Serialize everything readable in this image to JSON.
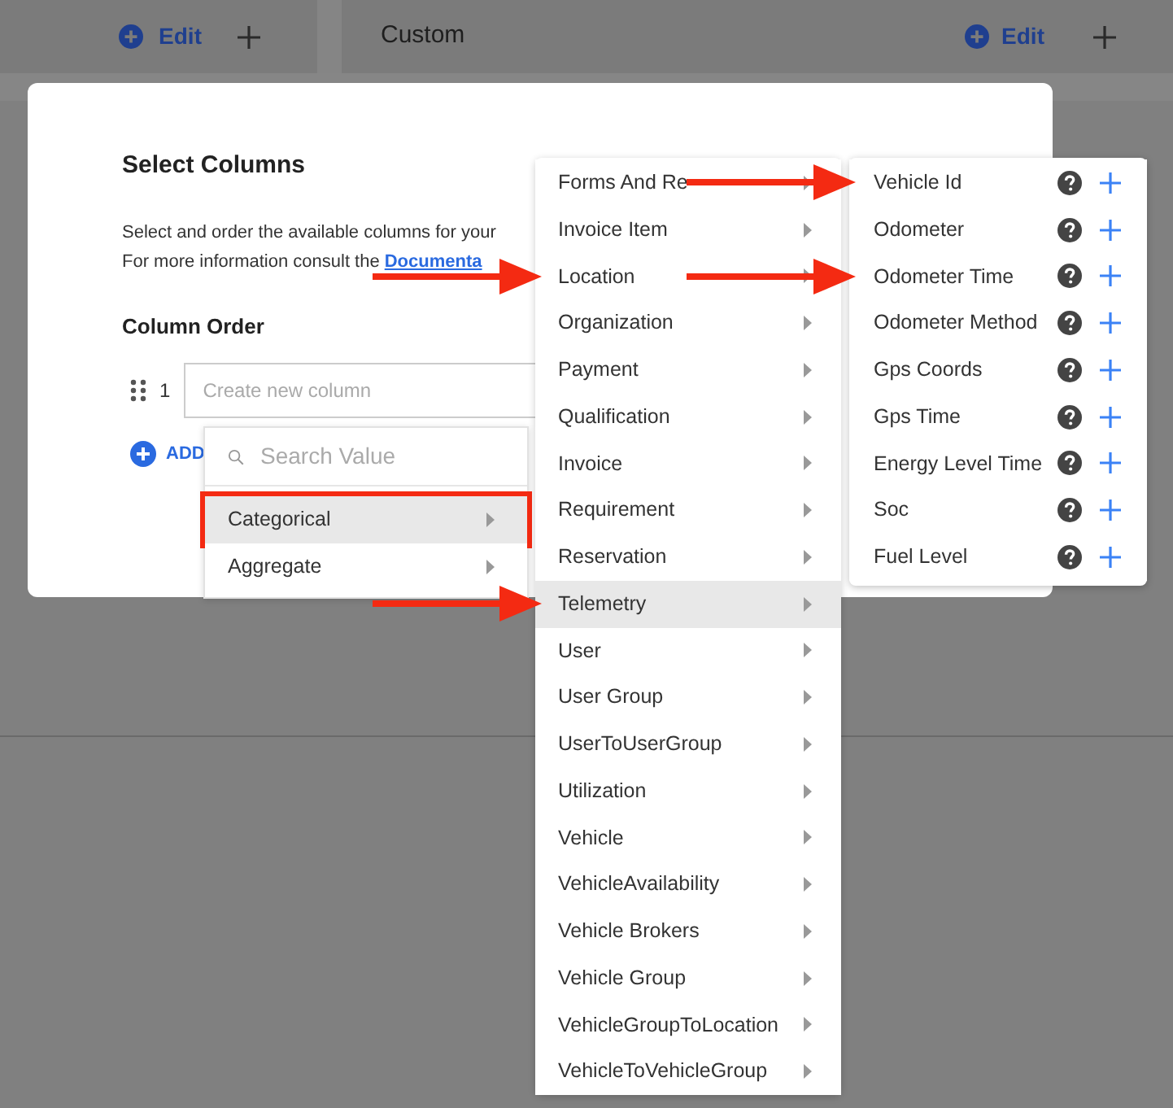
{
  "header": {
    "left_edit": "Edit",
    "custom_title": "Custom",
    "right_edit": "Edit"
  },
  "modal": {
    "title": "Select Columns",
    "description": "Select and order the available columns for your",
    "info_text": "For more information consult the ",
    "info_link": "Documenta",
    "section_label": "Column Order",
    "rows": [
      {
        "number": "1",
        "placeholder": "Create new column"
      }
    ],
    "add_label": "ADD"
  },
  "search_menu": {
    "placeholder": "Search Value",
    "items": [
      {
        "label": "Categorical",
        "selected": true,
        "boxed": true
      },
      {
        "label": "Aggregate",
        "selected": false,
        "boxed": false
      }
    ]
  },
  "category_menu": {
    "items": [
      {
        "label": "Forms And Re",
        "selected": false,
        "arrow": false
      },
      {
        "label": "Invoice Item",
        "selected": false,
        "arrow": false
      },
      {
        "label": "Location",
        "selected": false,
        "arrow": true
      },
      {
        "label": "Organization",
        "selected": false,
        "arrow": false
      },
      {
        "label": "Payment",
        "selected": false,
        "arrow": false
      },
      {
        "label": "Qualification",
        "selected": false,
        "arrow": false
      },
      {
        "label": "Invoice",
        "selected": false,
        "arrow": false
      },
      {
        "label": "Requirement",
        "selected": false,
        "arrow": false
      },
      {
        "label": "Reservation",
        "selected": false,
        "arrow": false
      },
      {
        "label": "Telemetry",
        "selected": true,
        "arrow": true
      },
      {
        "label": "User",
        "selected": false,
        "arrow": false
      },
      {
        "label": "User Group",
        "selected": false,
        "arrow": false
      },
      {
        "label": "UserToUserGroup",
        "selected": false,
        "arrow": false
      },
      {
        "label": "Utilization",
        "selected": false,
        "arrow": false
      },
      {
        "label": "Vehicle",
        "selected": false,
        "arrow": false
      },
      {
        "label": "VehicleAvailability",
        "selected": false,
        "arrow": false
      },
      {
        "label": "Vehicle Brokers",
        "selected": false,
        "arrow": false
      },
      {
        "label": "Vehicle Group",
        "selected": false,
        "arrow": false
      },
      {
        "label": "VehicleGroupToLocation",
        "selected": false,
        "arrow": false
      },
      {
        "label": "VehicleToVehicleGroup",
        "selected": false,
        "arrow": false
      }
    ]
  },
  "field_menu": {
    "items": [
      {
        "label": "Vehicle Id",
        "arrow": true
      },
      {
        "label": "Odometer",
        "arrow": false
      },
      {
        "label": "Odometer Time",
        "arrow": true
      },
      {
        "label": "Odometer Method",
        "arrow": false
      },
      {
        "label": "Gps Coords",
        "arrow": false
      },
      {
        "label": "Gps Time",
        "arrow": false
      },
      {
        "label": "Energy Level Time",
        "arrow": false
      },
      {
        "label": "Soc",
        "arrow": false
      },
      {
        "label": "Fuel Level",
        "arrow": false
      }
    ]
  }
}
